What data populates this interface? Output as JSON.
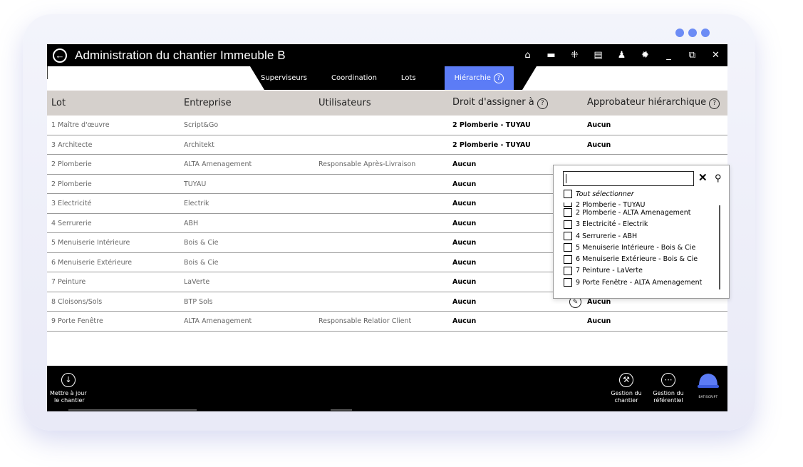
{
  "window": {
    "title": "Administration du chantier Immeuble B",
    "back_glyph": "←"
  },
  "title_icons": [
    {
      "name": "home-icon",
      "glyph": "⌂"
    },
    {
      "name": "folder-icon",
      "glyph": "▬"
    },
    {
      "name": "grid-icon",
      "glyph": "⁜"
    },
    {
      "name": "clipboard-icon",
      "glyph": "▤"
    },
    {
      "name": "user-icon",
      "glyph": "♟"
    },
    {
      "name": "gear-icon",
      "glyph": "✹"
    },
    {
      "name": "minimize-icon",
      "glyph": "_"
    },
    {
      "name": "restore-icon",
      "glyph": "⧉"
    },
    {
      "name": "close-icon",
      "glyph": "✕"
    }
  ],
  "tabs": [
    {
      "label": "Superviseurs"
    },
    {
      "label": "Coordination"
    },
    {
      "label": "Lots"
    },
    {
      "label": "Hiérarchie",
      "active": true
    }
  ],
  "table": {
    "headers": [
      "Lot",
      "Entreprise",
      "Utilisateurs",
      "Droit d'assigner à",
      "Approbateur hiérarchique"
    ],
    "rows": [
      {
        "lot": "1 Maître d'œuvre",
        "entreprise": "Script&Go",
        "utilisateurs": "",
        "droit": "2 Plomberie - TUYAU",
        "approbateur": "Aucun"
      },
      {
        "lot": "3 Architecte",
        "entreprise": "Architekt",
        "utilisateurs": "",
        "droit": "2 Plomberie - TUYAU",
        "approbateur": "Aucun"
      },
      {
        "lot": "2 Plomberie",
        "entreprise": "ALTA Amenagement",
        "utilisateurs": "Responsable Après-Livraison",
        "droit": "Aucun",
        "approbateur": ""
      },
      {
        "lot": "2 Plomberie",
        "entreprise": "TUYAU",
        "utilisateurs": "",
        "droit": "Aucun",
        "approbateur": ""
      },
      {
        "lot": "3 Electricité",
        "entreprise": "Electrik",
        "utilisateurs": "",
        "droit": "Aucun",
        "approbateur": ""
      },
      {
        "lot": "4 Serrurerie",
        "entreprise": "ABH",
        "utilisateurs": "",
        "droit": "Aucun",
        "approbateur": ""
      },
      {
        "lot": "5 Menuiserie Intérieure",
        "entreprise": "Bois & Cie",
        "utilisateurs": "",
        "droit": "Aucun",
        "approbateur": ""
      },
      {
        "lot": "6 Menuiserie Extérieure",
        "entreprise": "Bois & Cie",
        "utilisateurs": "",
        "droit": "Aucun",
        "approbateur": ""
      },
      {
        "lot": "7 Peinture",
        "entreprise": "LaVerte",
        "utilisateurs": "",
        "droit": "Aucun",
        "approbateur": ""
      },
      {
        "lot": "8 Cloisons/Sols",
        "entreprise": "BTP Sols",
        "utilisateurs": "",
        "droit": "Aucun",
        "approbateur": "Aucun",
        "editing": true
      },
      {
        "lot": "9 Porte Fenêtre",
        "entreprise": "ALTA Amenagement",
        "utilisateurs": "Responsable  Relatior Client",
        "droit": "Aucun",
        "approbateur": "Aucun"
      }
    ]
  },
  "dropdown": {
    "search_value": "",
    "select_all": "Tout sélectionner",
    "partial_item": "2 Plomberie - TUYAU",
    "items": [
      "2 Plomberie - ALTA Amenagement",
      "3 Electricité - Electrik",
      "4 Serrurerie - ABH",
      "5 Menuiserie Intérieure - Bois & Cie",
      "6 Menuiserie Extérieure - Bois & Cie",
      "7 Peinture - LaVerte",
      "9 Porte Fenêtre - ALTA Amenagement"
    ]
  },
  "bottombar": {
    "update_label_1": "Mettre à jour",
    "update_label_2": "le chantier",
    "site_mgmt_1": "Gestion du",
    "site_mgmt_2": "chantier",
    "ref_mgmt_1": "Gestion du",
    "ref_mgmt_2": "référentiel",
    "brand": "BATISCRIPT"
  },
  "colors": {
    "accent": "#5c7cf6",
    "header_bg": "#d5d0cc",
    "bar_bg": "#000000"
  }
}
